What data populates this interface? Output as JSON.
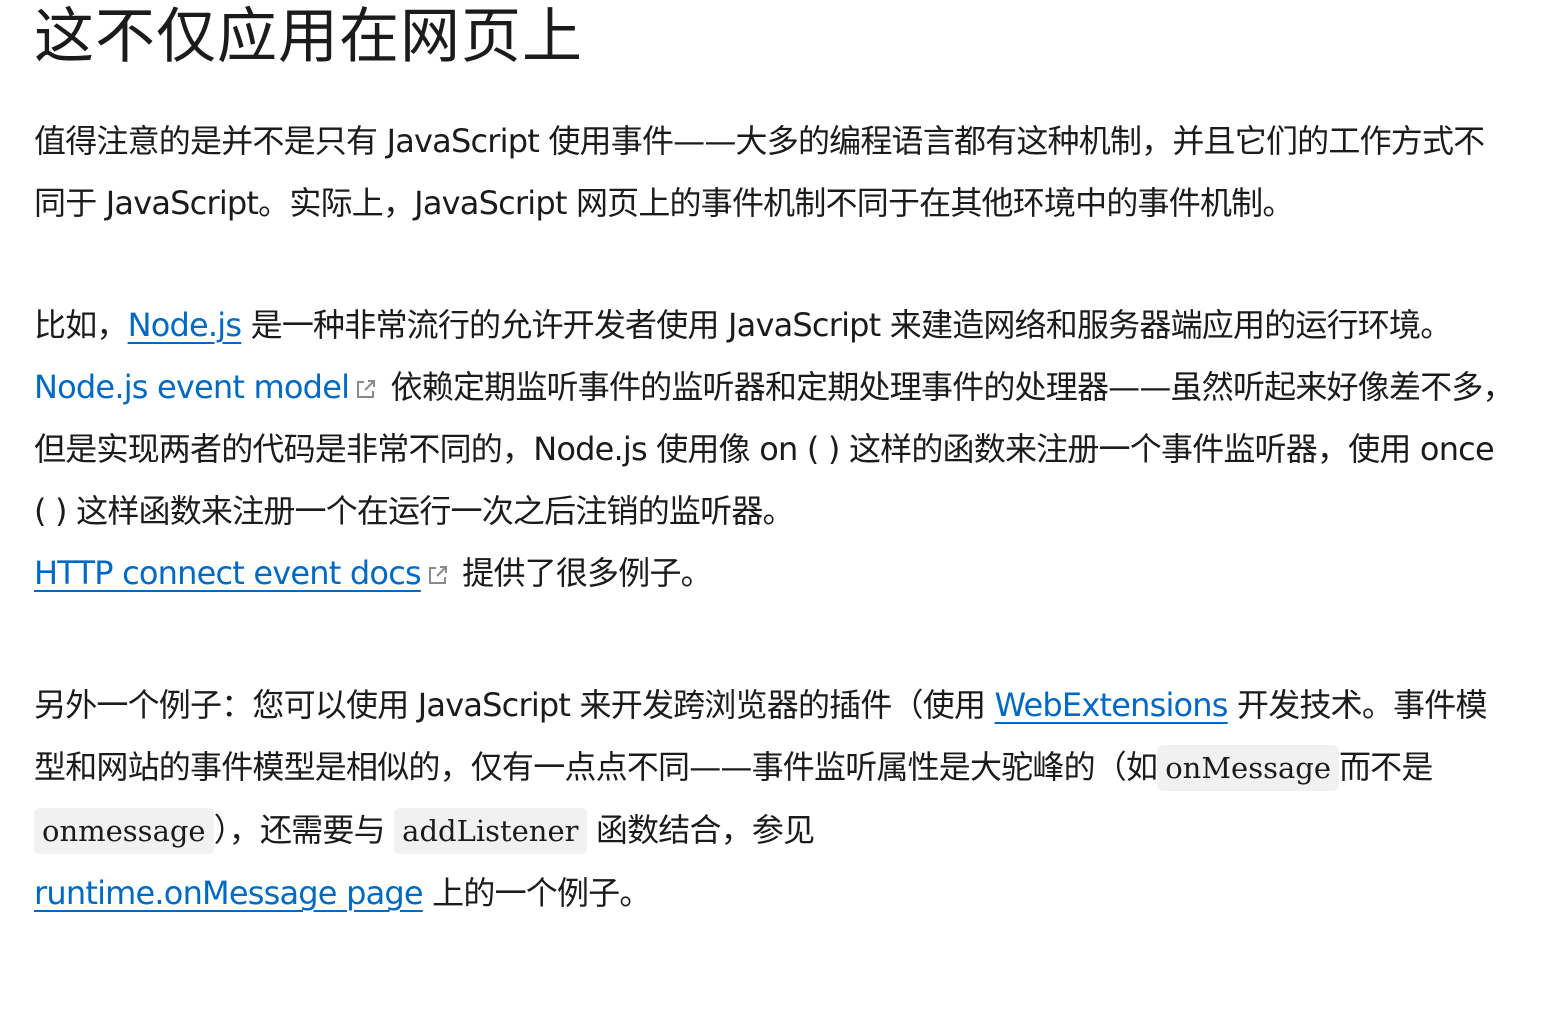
{
  "heading": "这不仅应用在网页上",
  "p1": {
    "text": "值得注意的是并不是只有 JavaScript 使用事件——大多的编程语言都有这种机制，并且它们的工作方式不同于 JavaScript。实际上，JavaScript 网页上的事件机制不同于在其他环境中的事件机制。"
  },
  "p2": {
    "t1": "比如，",
    "link_node": "Node.js",
    "t2": " 是一种非常流行的允许开发者使用 JavaScript 来建造网络和服务器端应用的运行环境。",
    "link_event_model": "Node.js event model",
    "t3": " 依赖定期监听事件的监听器和定期处理事件的处理器——虽然听起来好像差不多，但是实现两者的代码是非常不同的，Node.js 使用像 on ( ) 这样的函数来注册一个事件监听器，使用 once ( ) 这样函数来注册一个在运行一次之后注销的监听器。",
    "link_http": "HTTP connect event docs",
    "t4": " 提供了很多例子。"
  },
  "p3": {
    "t1": "另外一个例子：您可以使用 JavaScript 来开发跨浏览器的插件（使用 ",
    "link_webext": "WebExtensions",
    "t2": " 开发技术。事件模型和网站的事件模型是相似的，仅有一点点不同——事件监听属性是大驼峰的（如",
    "code1": "onMessage",
    "t3": "而不是",
    "code2": "onmessage",
    "t4": "），还需要与 ",
    "code3": "addListener",
    "t5": " 函数结合，参见",
    "link_runtime": "runtime.onMessage page",
    "t6": " 上的一个例子。"
  },
  "icons": {
    "external": "external-link-icon"
  },
  "colors": {
    "link": "#0069c2",
    "text": "#1b1b1b",
    "code_bg": "#f2f1f1"
  }
}
